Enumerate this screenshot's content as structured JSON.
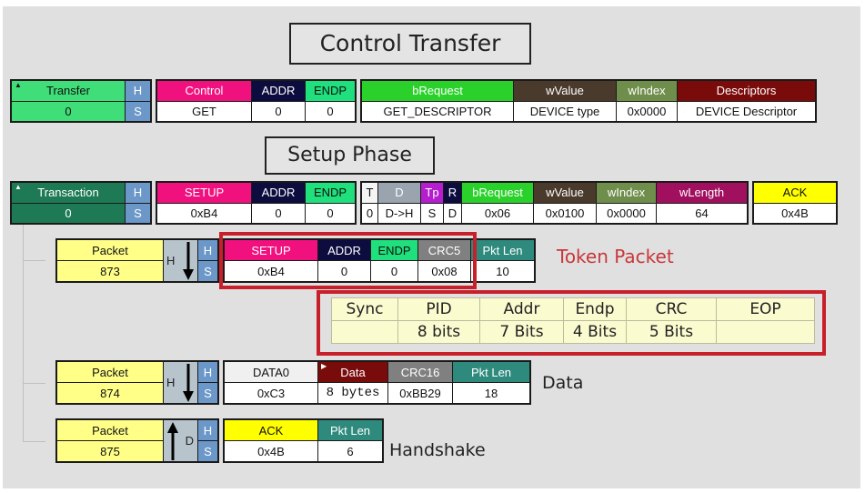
{
  "titles": {
    "control_transfer": "Control Transfer",
    "setup_phase": "Setup Phase"
  },
  "colors": {
    "transfer_green": "#3fde78",
    "transaction_green": "#1d7a55",
    "control_pink": "#f0117f",
    "addr_navy": "#0c0c3e",
    "endp_green": "#1fe07c",
    "brequest_green": "#2ad12a",
    "wvalue_brown": "#4a3a2c",
    "windex_olive": "#6f8e4c",
    "descriptors_maroon": "#7a0b0b",
    "wlength_magenta": "#a0105f",
    "tp_purple": "#b41ecf",
    "d_gray": "#9aa4ae",
    "ack_yellow": "#ffff00",
    "packet_yellow": "#ffff88",
    "crc_gray": "#808080",
    "pktlen_teal": "#2f8a7e",
    "hs_blue": "#6b97c9",
    "highlight_red": "#c8202a"
  },
  "transfer": {
    "label": "Transfer",
    "value": "0",
    "h": "H",
    "s": "S",
    "control": {
      "header": "Control",
      "value": "GET"
    },
    "addr": {
      "header": "ADDR",
      "value": "0"
    },
    "endp": {
      "header": "ENDP",
      "value": "0"
    },
    "brequest": {
      "header": "bRequest",
      "value": "GET_DESCRIPTOR"
    },
    "wvalue": {
      "header": "wValue",
      "value": "DEVICE type"
    },
    "windex": {
      "header": "wIndex",
      "value": "0x0000"
    },
    "descriptors": {
      "header": "Descriptors",
      "value": "DEVICE Descriptor"
    }
  },
  "transaction": {
    "label": "Transaction",
    "value": "0",
    "h": "H",
    "s": "S",
    "setup": {
      "header": "SETUP",
      "value": "0xB4"
    },
    "addr": {
      "header": "ADDR",
      "value": "0"
    },
    "endp": {
      "header": "ENDP",
      "value": "0"
    },
    "t": {
      "header": "T",
      "value": "0"
    },
    "d": {
      "header": "D",
      "value": "D->H"
    },
    "tp": {
      "header": "Tp",
      "value": "S"
    },
    "r": {
      "header": "R",
      "value": "D"
    },
    "brequest": {
      "header": "bRequest",
      "value": "0x06"
    },
    "wvalue": {
      "header": "wValue",
      "value": "0x0100"
    },
    "windex": {
      "header": "wIndex",
      "value": "0x0000"
    },
    "wlength": {
      "header": "wLength",
      "value": "64"
    },
    "ack": {
      "header": "ACK",
      "value": "0x4B"
    }
  },
  "packets": [
    {
      "label": "Packet",
      "number": "873",
      "direction": "H",
      "arrow": "down",
      "h": "H",
      "s": "S",
      "fields": [
        {
          "header": "SETUP",
          "value": "0xB4"
        },
        {
          "header": "ADDR",
          "value": "0"
        },
        {
          "header": "ENDP",
          "value": "0"
        },
        {
          "header": "CRC5",
          "value": "0x08"
        },
        {
          "header": "Pkt Len",
          "value": "10"
        }
      ],
      "annotation": "Token Packet"
    },
    {
      "label": "Packet",
      "number": "874",
      "direction": "H",
      "arrow": "down",
      "h": "H",
      "s": "S",
      "fields": [
        {
          "header": "DATA0",
          "value": "0xC3"
        },
        {
          "header": "Data",
          "value": "8 bytes"
        },
        {
          "header": "CRC16",
          "value": "0xBB29"
        },
        {
          "header": "Pkt Len",
          "value": "18"
        }
      ],
      "annotation": "Data"
    },
    {
      "label": "Packet",
      "number": "875",
      "direction": "D",
      "arrow": "up",
      "h": "H",
      "s": "S",
      "fields": [
        {
          "header": "ACK",
          "value": "0x4B"
        },
        {
          "header": "Pkt Len",
          "value": "6"
        }
      ],
      "annotation": "Handshake"
    }
  ],
  "token_format": {
    "headers": [
      "Sync",
      "PID",
      "Addr",
      "Endp",
      "CRC",
      "EOP"
    ],
    "sizes": [
      "",
      "8 bits",
      "7 Bits",
      "4 Bits",
      "5 Bits",
      ""
    ]
  }
}
